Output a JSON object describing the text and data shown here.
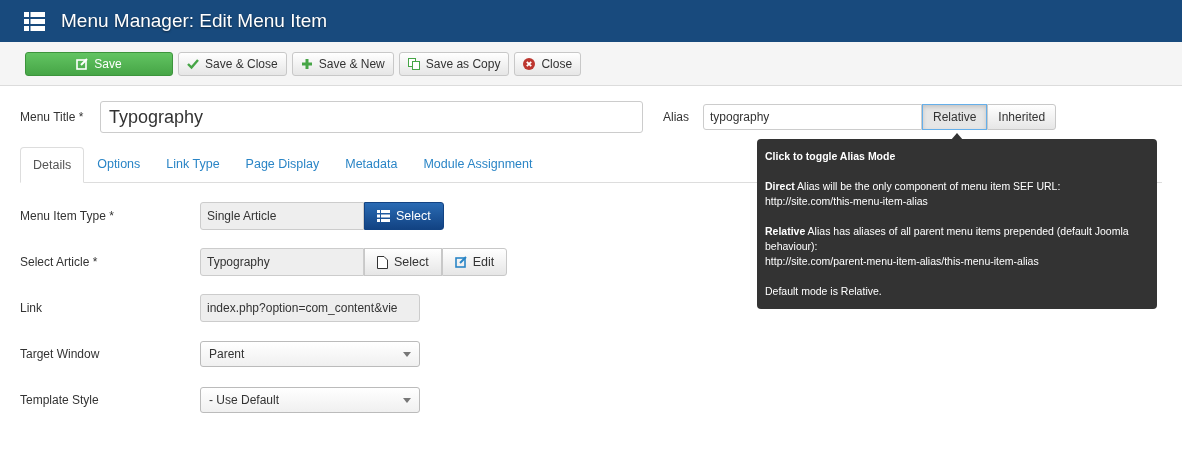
{
  "header": {
    "title": "Menu Manager: Edit Menu Item"
  },
  "toolbar": [
    {
      "label": "Save",
      "kind": "primary"
    },
    {
      "label": "Save & Close",
      "kind": "default"
    },
    {
      "label": "Save & New",
      "kind": "default"
    },
    {
      "label": "Save as Copy",
      "kind": "default"
    },
    {
      "label": "Close",
      "kind": "default"
    }
  ],
  "title_field": {
    "label": "Menu Title *",
    "value": "Typography"
  },
  "alias": {
    "label": "Alias",
    "value": "typography",
    "modes": [
      {
        "label": "Relative",
        "selected": true
      },
      {
        "label": "Inherited",
        "selected": false
      }
    ]
  },
  "tabs": [
    {
      "label": "Details",
      "selected": true
    },
    {
      "label": "Options",
      "selected": false
    },
    {
      "label": "Link Type",
      "selected": false
    },
    {
      "label": "Page Display",
      "selected": false
    },
    {
      "label": "Metadata",
      "selected": false
    },
    {
      "label": "Module Assignment",
      "selected": false
    }
  ],
  "fields": [
    {
      "label": "Menu Item Type *",
      "kind": "picker",
      "value": "Single Article",
      "buttons": [
        {
          "label": "Select",
          "kind": "primary"
        }
      ]
    },
    {
      "label": "Select Article *",
      "kind": "picker",
      "value": "Typography",
      "buttons": [
        {
          "label": "Select",
          "kind": "default"
        },
        {
          "label": "Edit",
          "kind": "default"
        }
      ]
    },
    {
      "label": "Link",
      "kind": "readonly",
      "value": "index.php?option=com_content&vie"
    },
    {
      "label": "Target Window",
      "kind": "dropdown",
      "value": "Parent"
    },
    {
      "label": "Template Style",
      "kind": "dropdown",
      "value": "- Use Default"
    }
  ],
  "tooltip": {
    "title": "Click to toggle Alias Mode",
    "paragraphs": [
      [
        "**Direct** Alias will be the only component of menu item SEF URL:",
        "http://site.com/this-menu-item-alias"
      ],
      [
        "**Relative** Alias has aliases of all parent menu items prepended (default Joomla behaviour):",
        "http://site.com/parent-menu-item-alias/this-menu-item-alias"
      ],
      [
        "Default mode is Relative."
      ]
    ]
  }
}
